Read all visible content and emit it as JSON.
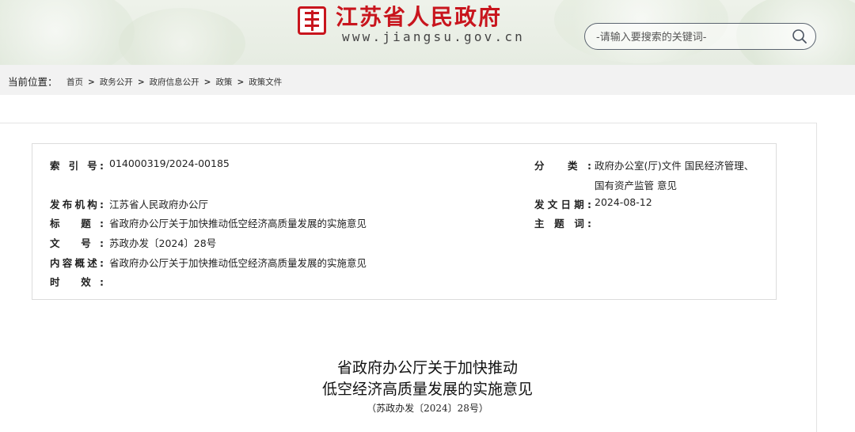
{
  "header": {
    "site_title": "江苏省人民政府",
    "site_url": "www.jiangsu.gov.cn",
    "search_placeholder": "-请输入要搜索的关键词-"
  },
  "breadcrumb": {
    "label": "当前位置：",
    "items": [
      "首页",
      "政务公开",
      "政府信息公开",
      "政策",
      "政策文件"
    ]
  },
  "info": {
    "index_label": "索 引 号:",
    "index_value": "014000319/2024-00185",
    "category_label": "分 类:",
    "category_value_line1": "政府办公室(厅)文件 国民经济管理、",
    "category_value_line2": "国有资产监管 意见",
    "publisher_label": "发布机构:",
    "publisher_value": "江苏省人民政府办公厅",
    "date_label": "发文日期:",
    "date_value": "2024-08-12",
    "title_label": "标 题:",
    "title_value": "省政府办公厅关于加快推动低空经济高质量发展的实施意见",
    "subject_label": "主 题 词:",
    "subject_value": "",
    "docno_label": "文 号:",
    "docno_value": "苏政办发〔2024〕28号",
    "summary_label": "内容概述:",
    "summary_value": "省政府办公厅关于加快推动低空经济高质量发展的实施意见",
    "validity_label": "时 效:",
    "validity_value": ""
  },
  "document": {
    "title_line1": "省政府办公厅关于加快推动",
    "title_line2": "低空经济高质量发展的实施意见",
    "doc_number": "（苏政办发〔2024〕28号）"
  },
  "colors": {
    "brand_red": "#c8151d",
    "header_bg": "#e6ece2",
    "crumb_bg": "#f2f2f2"
  }
}
